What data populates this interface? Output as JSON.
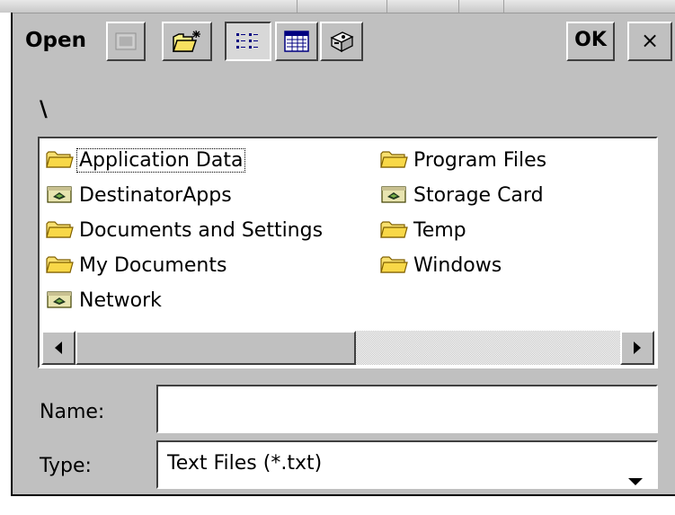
{
  "dialog": {
    "title": "Open",
    "ok_label": "OK",
    "close_label": "×",
    "toolbar_icons": [
      "up-folder-icon",
      "new-folder-icon",
      "list-view-icon",
      "details-view-icon",
      "properties-icon"
    ]
  },
  "path": "\\",
  "files": [
    {
      "name": "Application Data",
      "icon": "folder-icon",
      "column": 0,
      "row": 0,
      "focused": true
    },
    {
      "name": "DestinatorApps",
      "icon": "storage-card-icon",
      "column": 0,
      "row": 1
    },
    {
      "name": "Documents and Settings",
      "icon": "folder-icon",
      "column": 0,
      "row": 2
    },
    {
      "name": "My Documents",
      "icon": "folder-icon",
      "column": 0,
      "row": 3
    },
    {
      "name": "Network",
      "icon": "storage-card-icon",
      "column": 0,
      "row": 4
    },
    {
      "name": "Program Files",
      "icon": "folder-icon",
      "column": 1,
      "row": 0
    },
    {
      "name": "Storage Card",
      "icon": "storage-card-icon",
      "column": 1,
      "row": 1
    },
    {
      "name": "Temp",
      "icon": "folder-icon",
      "column": 1,
      "row": 2
    },
    {
      "name": "Windows",
      "icon": "folder-icon",
      "column": 1,
      "row": 3
    }
  ],
  "form": {
    "name_label": "Name:",
    "name_value": "",
    "type_label": "Type:",
    "type_value": "Text Files (*.txt)"
  },
  "colors": {
    "dialog_bg": "#c0c0c0",
    "folder_yellow": "#f8d848"
  }
}
